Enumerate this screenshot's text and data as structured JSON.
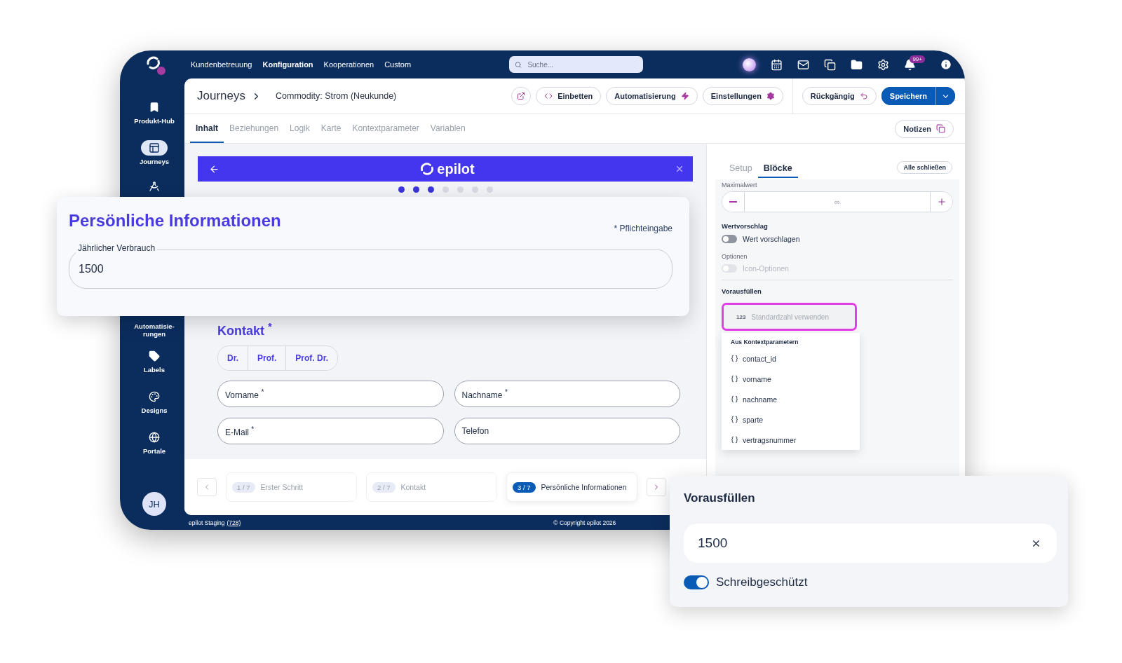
{
  "top_bar": {
    "nav": [
      {
        "label": "Kundenbetreuung",
        "selected": false
      },
      {
        "label": "Konfiguration",
        "selected": true
      },
      {
        "label": "Kooperationen",
        "selected": false
      },
      {
        "label": "Custom",
        "selected": false
      }
    ],
    "search": {
      "placeholder": "Suche..."
    },
    "notification_count": "99+"
  },
  "sidebar": {
    "items": [
      {
        "label": "Produkt-Hub",
        "selected": false
      },
      {
        "label": "Journeys",
        "selected": true
      },
      {
        "label": "Automatisie-rungen",
        "selected": false
      },
      {
        "label": "Labels",
        "selected": false
      },
      {
        "label": "Designs",
        "selected": false
      },
      {
        "label": "Portale",
        "selected": false
      }
    ],
    "avatar": "JH"
  },
  "header": {
    "section": "Journeys",
    "title": "Commodity: Strom (Neukunde)",
    "actions": [
      {
        "label": "Einbetten"
      },
      {
        "label": "Automatisierung"
      },
      {
        "label": "Einstellungen"
      }
    ],
    "undo": "Rückgängig",
    "save": "Speichern"
  },
  "content_tabs": [
    {
      "label": "Inhalt",
      "selected": true
    },
    {
      "label": "Beziehungen",
      "selected": false
    },
    {
      "label": "Logik",
      "selected": false
    },
    {
      "label": "Karte",
      "selected": false
    },
    {
      "label": "Kontextparameter",
      "selected": false
    },
    {
      "label": "Variablen",
      "selected": false
    }
  ],
  "notes_button": "Notizen",
  "preview": {
    "brand": "epilot",
    "dots": [
      {
        "active": true
      },
      {
        "active": true
      },
      {
        "active": true
      },
      {
        "active": false
      },
      {
        "active": false
      },
      {
        "active": false
      },
      {
        "active": false
      }
    ],
    "form": {
      "heading": "Kontakt $^{*}$",
      "salutations": [
        "Dr.",
        "Prof.",
        "Prof. Dr."
      ],
      "fields": [
        "Vorname $^{*}$",
        "Nachname $^{*}$",
        "E-Mail $^{*}$",
        "Telefon"
      ]
    }
  },
  "steps": [
    {
      "number": "1 / 7",
      "label": "Erster Schritt",
      "selected": false
    },
    {
      "number": "2 / 7",
      "label": "Kontakt",
      "selected": false
    },
    {
      "number": "3 / 7",
      "label": "Persönliche Informationen",
      "selected": true
    }
  ],
  "right_panel": {
    "tabs": [
      {
        "label": "Setup",
        "selected": false
      },
      {
        "label": "Blöcke",
        "selected": true
      }
    ],
    "collapse_all": "Alle schließen",
    "maximum": {
      "label": "Maximalwert",
      "placeholder": "∞"
    },
    "suggestion": {
      "heading": "Wertvorschlag",
      "label": "Wert vorschlagen",
      "on": false,
      "disabled": false
    },
    "options": {
      "heading": "Optionen",
      "label": "Icon-Optionen",
      "on": false,
      "disabled": true
    },
    "prefill": {
      "heading": "Vorausfüllen",
      "type_badge": "123",
      "placeholder": "Standardzahl verwenden",
      "menu": {
        "group": "Aus Kontextparametern",
        "items": [
          "contact_id",
          "vorname",
          "nachname",
          "sparte",
          "vertragsnummer"
        ]
      }
    }
  },
  "footer": {
    "environment": "epilot Staging",
    "build": "(728)",
    "copyright": "© Copyright epilot 2026"
  },
  "callouts": {
    "personal_info": {
      "title": "Persönliche Informationen",
      "required_note": "* Pflichteingabe",
      "field": {
        "label": "Jährlicher Verbrauch",
        "value": "1500"
      }
    },
    "prefill": {
      "title": "Vorausfüllen",
      "value": "1500",
      "read_only": {
        "label": "Schreibgeschützt",
        "on": true
      }
    }
  }
}
